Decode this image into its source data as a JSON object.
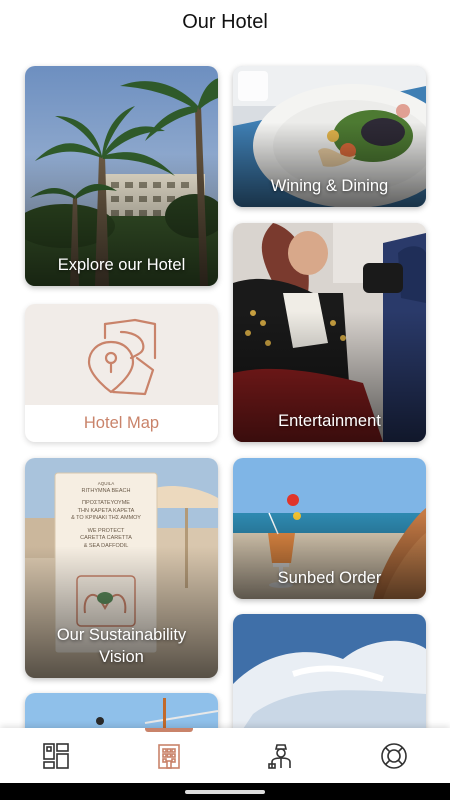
{
  "header": {
    "title": "Our Hotel"
  },
  "cards": {
    "explore": {
      "label": "Explore our Hotel"
    },
    "wining": {
      "label": "Wining & Dining"
    },
    "map": {
      "label": "Hotel Map"
    },
    "entertainment": {
      "label": "Entertainment"
    },
    "sustainability": {
      "label": "Our Sustainability Vision"
    },
    "sunbed": {
      "label": "Sunbed Order"
    }
  },
  "sign": {
    "brand_small": "AQUILA",
    "brand": "RITHYMNA BEACH",
    "greek_line1": "ΠΡΟΣΤΑΤΕΥΟΥΜΕ",
    "greek_line2": "ΤΗΝ ΚΑΡΕΤΑ ΚΑΡΕΤΑ",
    "greek_line3": "& ΤΟ ΚΡΙΝΑΚΙ ΤΗΣ ΑΜΜΟΥ",
    "en_line1": "WE PROTECT",
    "en_line2": "CARETTA CARETTA",
    "en_line3": "& SEA DAFFODIL"
  },
  "nav": {
    "tabs": [
      {
        "name": "dashboard",
        "icon": "dashboard-grid-icon",
        "active": false
      },
      {
        "name": "hotel",
        "icon": "hotel-building-icon",
        "active": true
      },
      {
        "name": "concierge",
        "icon": "concierge-person-icon",
        "active": false
      },
      {
        "name": "help",
        "icon": "lifebuoy-icon",
        "active": false
      }
    ]
  },
  "colors": {
    "accent": "#c9836a",
    "background": "#ffffff",
    "map_card_bg": "#f1ece8"
  }
}
